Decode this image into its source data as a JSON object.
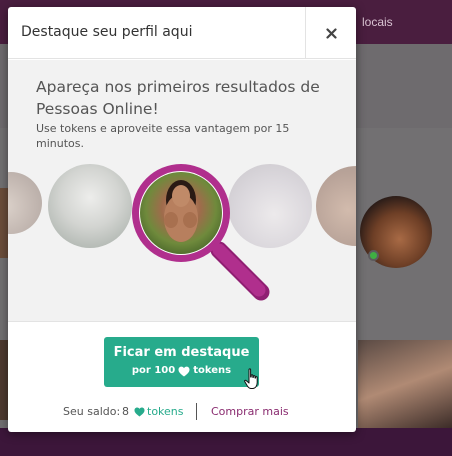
{
  "background": {
    "topbar_partial_text": "locais"
  },
  "modal": {
    "title": "Destaque seu perfil aqui",
    "close_icon": "close-icon",
    "promo": {
      "heading": "Apareça nos primeiros resultados de Pessoas Online!",
      "subtext": "Use tokens e aproveite essa vantagem por 15 minutos."
    },
    "cta": {
      "label": "Ficar em destaque",
      "price_prefix": "por 100",
      "price_suffix": "tokens",
      "price_icon": "heart-icon"
    },
    "balance": {
      "label": "Seu saldo:",
      "value": "8",
      "unit": "tokens",
      "unit_icon": "heart-icon"
    },
    "buy_more": "Comprar mais"
  },
  "colors": {
    "accent_green": "#27ab8c",
    "brand_purple": "#8a2c70",
    "magnifier_magenta": "#b02f8d"
  }
}
